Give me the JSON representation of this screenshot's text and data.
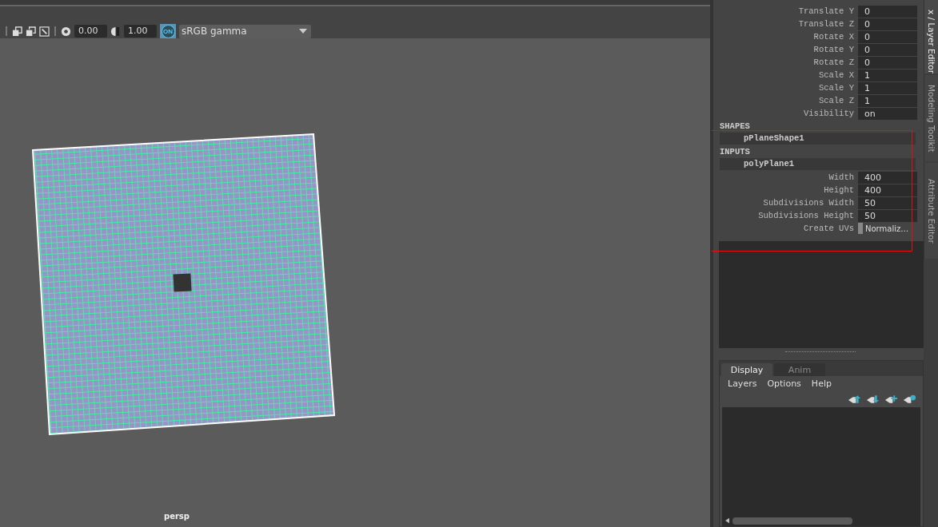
{
  "toolbar": {
    "exposure": "0.00",
    "gamma": "1.00",
    "view_transform_toggle": {
      "label": "ON",
      "on": true
    },
    "color_space": "sRGB gamma"
  },
  "viewport": {
    "camera_label": "persp"
  },
  "channel_box": {
    "channels": [
      {
        "name": "Translate Y",
        "value": "0"
      },
      {
        "name": "Translate Z",
        "value": "0"
      },
      {
        "name": "Rotate X",
        "value": "0"
      },
      {
        "name": "Rotate Y",
        "value": "0"
      },
      {
        "name": "Rotate Z",
        "value": "0"
      },
      {
        "name": "Scale X",
        "value": "1"
      },
      {
        "name": "Scale Y",
        "value": "1"
      },
      {
        "name": "Scale Z",
        "value": "1"
      },
      {
        "name": "Visibility",
        "value": "on"
      }
    ],
    "shapes": {
      "header": "SHAPES",
      "items": [
        "pPlaneShape1"
      ]
    },
    "inputs": {
      "header": "INPUTS",
      "items": [
        "polyPlane1"
      ],
      "attributes": [
        {
          "name": "Width",
          "value": "400",
          "kind": "number"
        },
        {
          "name": "Height",
          "value": "400",
          "kind": "number"
        },
        {
          "name": "Subdivisions Width",
          "value": "50",
          "kind": "number"
        },
        {
          "name": "Subdivisions Height",
          "value": "50",
          "kind": "number"
        },
        {
          "name": "Create UVs",
          "value": "Normaliz…",
          "kind": "enum"
        }
      ]
    }
  },
  "layer_editor": {
    "tabs": [
      {
        "label": "Display",
        "selected": true
      },
      {
        "label": "Anim",
        "selected": false
      }
    ],
    "menus": [
      "Layers",
      "Options",
      "Help"
    ]
  },
  "side_tabs": [
    {
      "label": "x / Layer Editor",
      "selected": true
    },
    {
      "label": "Modeling Toolkit",
      "selected": false
    },
    {
      "label": "Attribute Editor",
      "selected": false
    }
  ]
}
